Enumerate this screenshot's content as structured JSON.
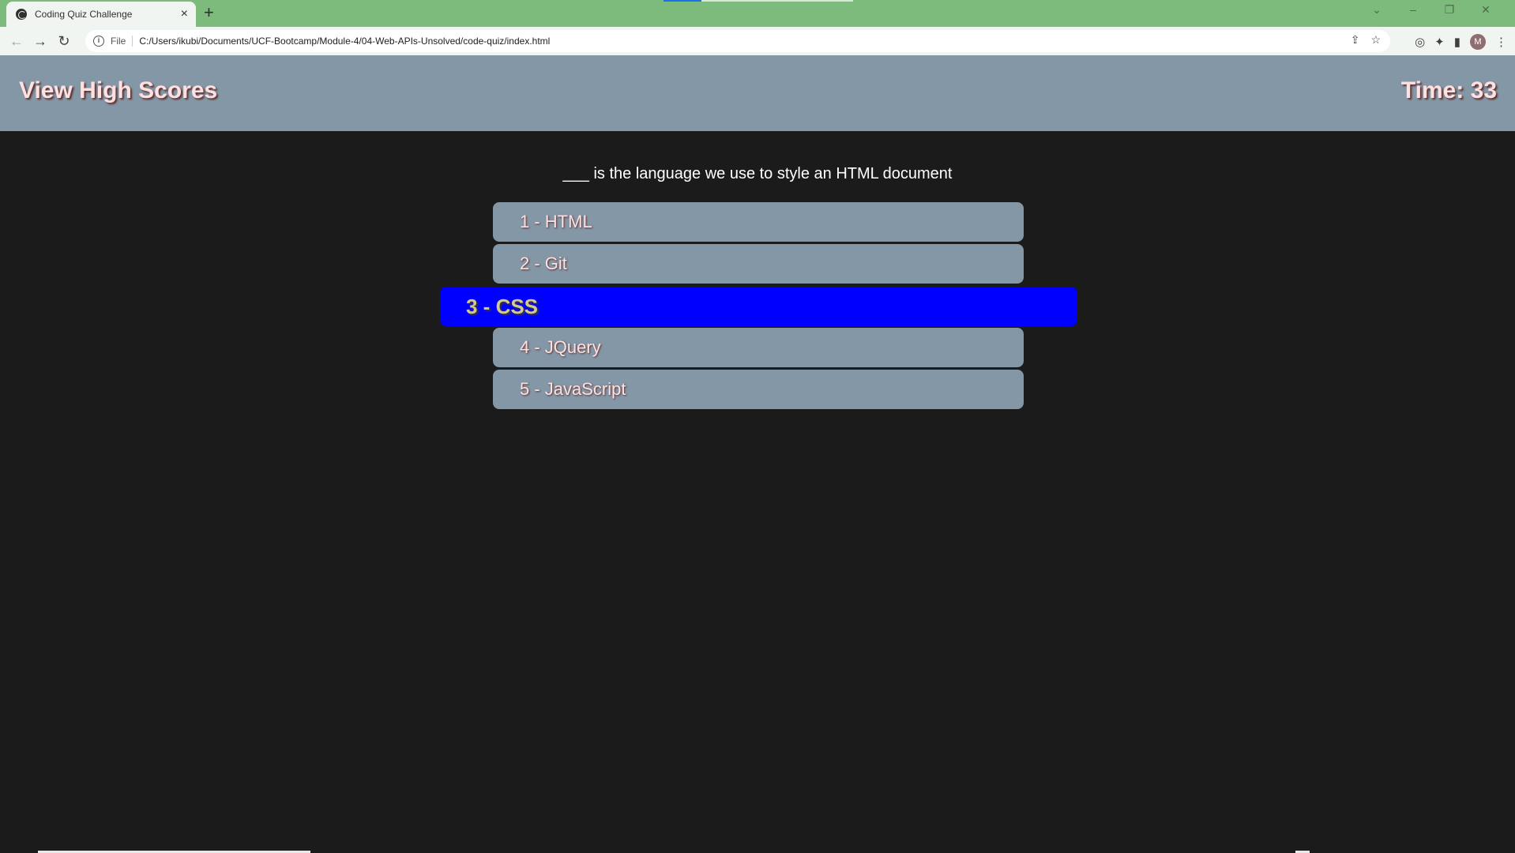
{
  "browser": {
    "tab_title": "Coding Quiz Challenge",
    "tab_close": "×",
    "new_tab": "+",
    "url_scheme_label": "File",
    "url": "C:/Users/ikubi/Documents/UCF-Bootcamp/Module-4/04-Web-APIs-Unsolved/code-quiz/index.html",
    "profile_initial": "M"
  },
  "header": {
    "high_scores_link": "View High Scores",
    "timer": "Time: 33"
  },
  "quiz": {
    "question": "___ is the language we use to style an HTML document",
    "answers": [
      {
        "label": "1 - HTML"
      },
      {
        "label": "2 - Git"
      },
      {
        "label": "3 - CSS",
        "highlighted": true
      },
      {
        "label": "4 - JQuery"
      },
      {
        "label": "5 - JavaScript"
      }
    ]
  },
  "colors": {
    "header_bg": "#8497a6",
    "page_bg": "#1b1b1b",
    "highlight_bg": "#0000ff",
    "tabbar_bg": "#7cbb7c"
  }
}
